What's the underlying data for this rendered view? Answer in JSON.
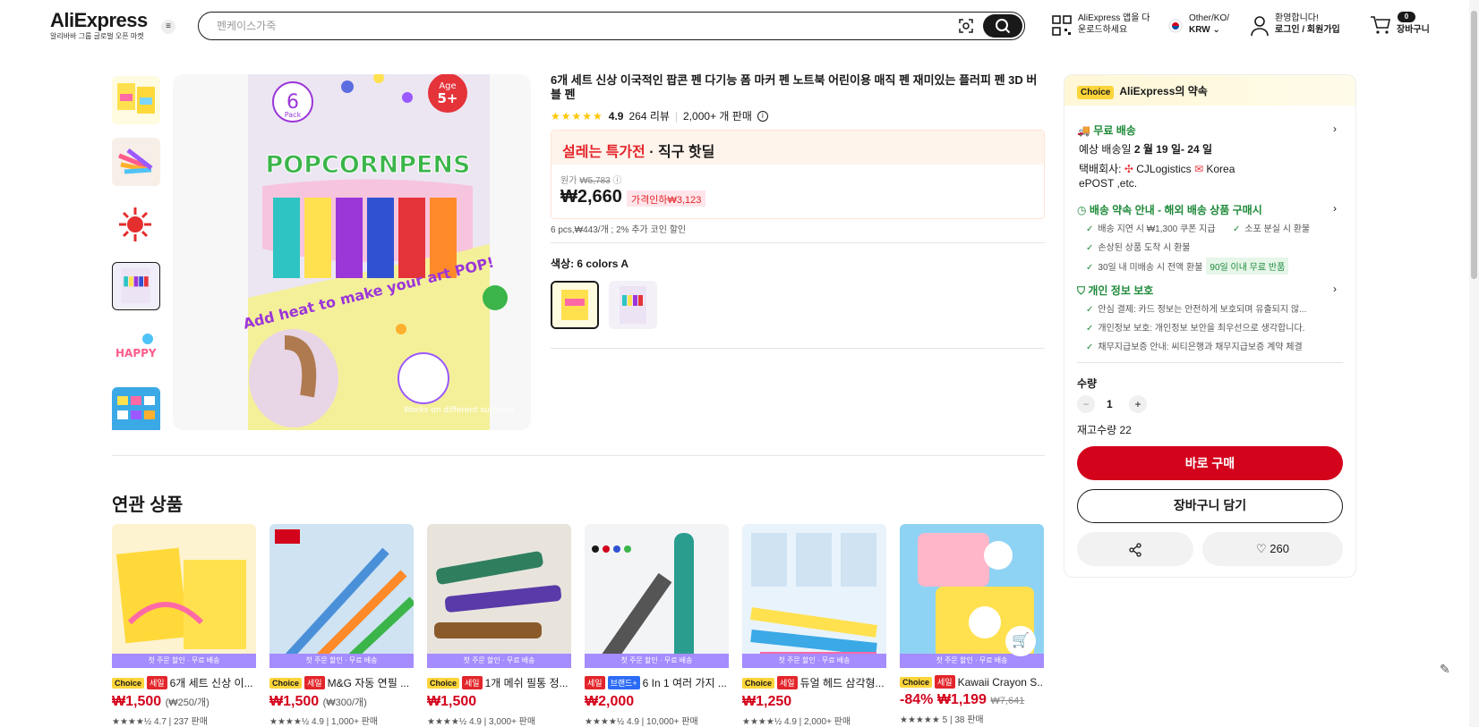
{
  "header": {
    "logo": "AliExpress",
    "logo_sub": "알리바바 그룹 글로벌 오픈 마켓",
    "search_placeholder": "펜케이스가죽",
    "app_line1": "AliExpress 앱을 다",
    "app_line2": "운로드하세요",
    "region_line1": "Other/KO/",
    "region_line2": "KRW",
    "welcome_line1": "환영합니다!",
    "welcome_line2": "로그인 / 회원가입",
    "cart_count": "0",
    "cart_label": "장바구니"
  },
  "product": {
    "title": "6개 세트 신상 이국적인 팝콘 펜 다기능 폼 마커 펜 노트북 어린이용 매직 펜 재미있는 플러피 펜 3D 버블 펜",
    "rating": "4.9",
    "reviews": "264 리뷰",
    "sold": "2,000+ 개 판매",
    "promo_red": "설레는 특가전",
    "promo_rest": " · 직구 핫딜",
    "orig_price_label": "원가",
    "orig_price": "₩5,783",
    "price": "₩2,660",
    "price_tag": "가격인하₩3,123",
    "per_unit": "6 pcs,₩443/개 ; 2% 추가 코인 할인",
    "color_label": "색상: 6 colors A"
  },
  "panel": {
    "choice_badge": "Choice",
    "head": "AliExpress의 약속",
    "free_ship": "무료 배송",
    "delivery_prefix": "예상 배송일 ",
    "delivery_date": "2 월 19 일- 24 일",
    "carrier_prefix": "택배회사:",
    "carrier1": "CJLogistics",
    "carrier2": "Korea",
    "carrier3": "ePOST ,etc.",
    "ship_promise": "배송 약속 안내 - 해외 배송 상품 구매시",
    "b1": "배송 지연 시 ₩1,300 쿠폰 지급",
    "b2": "소포 분실 시 환불",
    "b3": "손상된 상품 도착 시 환불",
    "b4": "30일 내 미배송 시 전액 환불",
    "b4_tag": "90일 이내 무료 반품",
    "privacy": "개인 정보 보호",
    "p1": "안심 결제: 카드 정보는 안전하게 보호되며 유출되지 않...",
    "p2": "개인정보 보호: 개인정보 보안을 최우선으로 생각합니다.",
    "p3": "채무지급보증 안내: 씨티은행과 채무지급보증 계약 체결",
    "qty_label": "수량",
    "qty": "1",
    "stock": "재고수량 22",
    "buy_now": "바로 구매",
    "add_cart": "장바구니 담기",
    "likes": "260"
  },
  "related": {
    "title": "연관 상품",
    "band": "첫 주문 할인 · 무료 배송",
    "items": [
      {
        "title": "6개 세트 신상 이...",
        "price": "₩1,500",
        "unit": "(₩250/개)",
        "meta": "4.7 | 237 판매"
      },
      {
        "title": "M&G 자동 연필 ...",
        "price": "₩1,500",
        "unit": "(₩300/개)",
        "meta": "4.9 | 1,000+ 판매"
      },
      {
        "title": "1개 메쉬 필통 정...",
        "price": "₩1,500",
        "unit": "",
        "meta": "4.9 | 3,000+ 판매"
      },
      {
        "title": "6 In 1 여러 가지 ...",
        "price": "₩2,000",
        "unit": "",
        "meta": "4.9 | 10,000+ 판매"
      },
      {
        "title": "듀얼 헤드 삼각형...",
        "price": "₩1,250",
        "unit": "",
        "meta": "4.9 | 2,000+ 판매"
      },
      {
        "title": "Kawaii Crayon S...",
        "discount": "-84%",
        "price": "₩1,199",
        "orig": "₩7,641",
        "meta": "5 | 38 판매"
      }
    ],
    "tag_choice": "Choice",
    "tag_sale": "세일",
    "tag_brand": "브랜드+"
  },
  "thumbs": [
    "thumb-1",
    "thumb-2",
    "thumb-3",
    "thumb-4",
    "thumb-5",
    "thumb-6"
  ],
  "main_image_text": {
    "pack_num": "6",
    "pack": "Pack",
    "age": "Age",
    "age_num": "5+",
    "brand": "POPCORNPENS",
    "slogan": "Add heat to make your art POP!",
    "works": "Works on different surfaces"
  },
  "colors": {
    "accent": "#d3031c",
    "choice": "#fcd53a",
    "green": "#1f8a3a",
    "band": "#a58cff"
  }
}
